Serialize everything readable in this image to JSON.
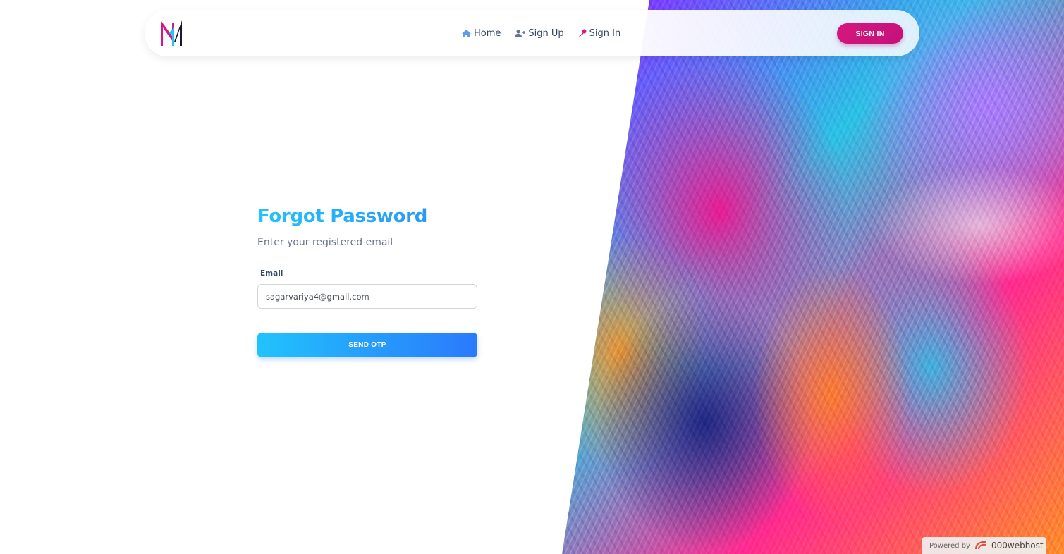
{
  "navbar": {
    "logo_alt": "M",
    "links": [
      {
        "label": "Home",
        "icon": "home-icon"
      },
      {
        "label": "Sign Up",
        "icon": "user-plus-icon"
      },
      {
        "label": "Sign In",
        "icon": "key-icon"
      }
    ],
    "signin_button": "SIGN IN"
  },
  "form": {
    "title": "Forgot Password",
    "subtitle": "Enter your registered email",
    "email_label": "Email",
    "email_value": "sagarvariya4@gmail.com",
    "submit_label": "SEND OTP"
  },
  "badge": {
    "powered_by": "Powered by",
    "brand": "000webhost"
  },
  "colors": {
    "accent": "#21c4fb",
    "primary_pink": "#d6177e",
    "text": "#344767"
  }
}
